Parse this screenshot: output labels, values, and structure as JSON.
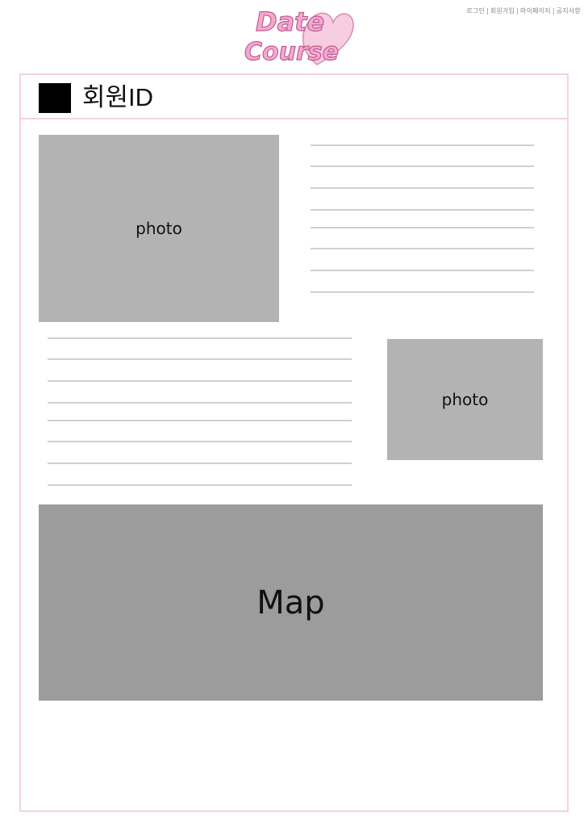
{
  "top_nav": {
    "links": [
      "로그인",
      "회원가입",
      "마이페이지",
      "공지사항"
    ],
    "separator": "|"
  },
  "logo": {
    "line1": "Date",
    "line2": "Course",
    "colors": {
      "fill": "#f5a9d0",
      "outline": "#c05a90",
      "heart": "#f7cde2"
    }
  },
  "header": {
    "member_id": "회원ID"
  },
  "photos": [
    "photo",
    "photo"
  ],
  "map": {
    "label": "Map"
  },
  "colors": {
    "frame_border": "#f3d2e2",
    "photo_bg": "#b3b3b3",
    "map_bg": "#9c9c9c",
    "line": "#d0d0d0"
  }
}
